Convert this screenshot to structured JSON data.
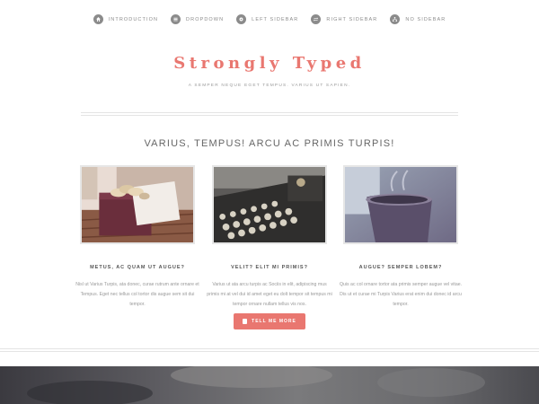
{
  "nav": {
    "items": [
      {
        "label": "Introduction",
        "icon": "home-icon"
      },
      {
        "label": "Dropdown",
        "icon": "bars-icon"
      },
      {
        "label": "Left Sidebar",
        "icon": "cog-icon"
      },
      {
        "label": "Right Sidebar",
        "icon": "retweet-icon"
      },
      {
        "label": "No Sidebar",
        "icon": "sitemap-icon"
      }
    ]
  },
  "header": {
    "title": "Strongly Typed",
    "tagline": "A semper neque eget tempus. Varius ut sapien."
  },
  "section": {
    "title": "Varius, tempus! Arcu ac primis turpis!",
    "features": [
      {
        "title": "Metus, ac quam ut augue?",
        "text": "Nisl ut Varius Turpis, ata donec, curae rutrum ante ornare et Tempus. Eget nec tellus col tortor dis augue sem sit dui tempor.",
        "image": "macarons-photo"
      },
      {
        "title": "Velit? Elit mi primis?",
        "text": "Varius ut ata arcu turpis ac Sociis in elit, adipiscing mus primis mi at vel dui id amet eget eu dolt tempor sit tempus mi tempor ornare nullam tellus vis nos.",
        "image": "typewriter-photo"
      },
      {
        "title": "Augue? Semper lobem?",
        "text": "Quis ac col ornare tortor ata primis semper augue vel vitae. Dis ut et curae mi Turpis Varius erat enim dui donec id arcu tempor.",
        "image": "coffee-mug-photo"
      }
    ],
    "button_label": "Tell Me More"
  },
  "colors": {
    "accent": "#e97770",
    "nav_gray": "#8b8b8b",
    "text_gray": "#999999",
    "rule": "#e4e4e4"
  }
}
